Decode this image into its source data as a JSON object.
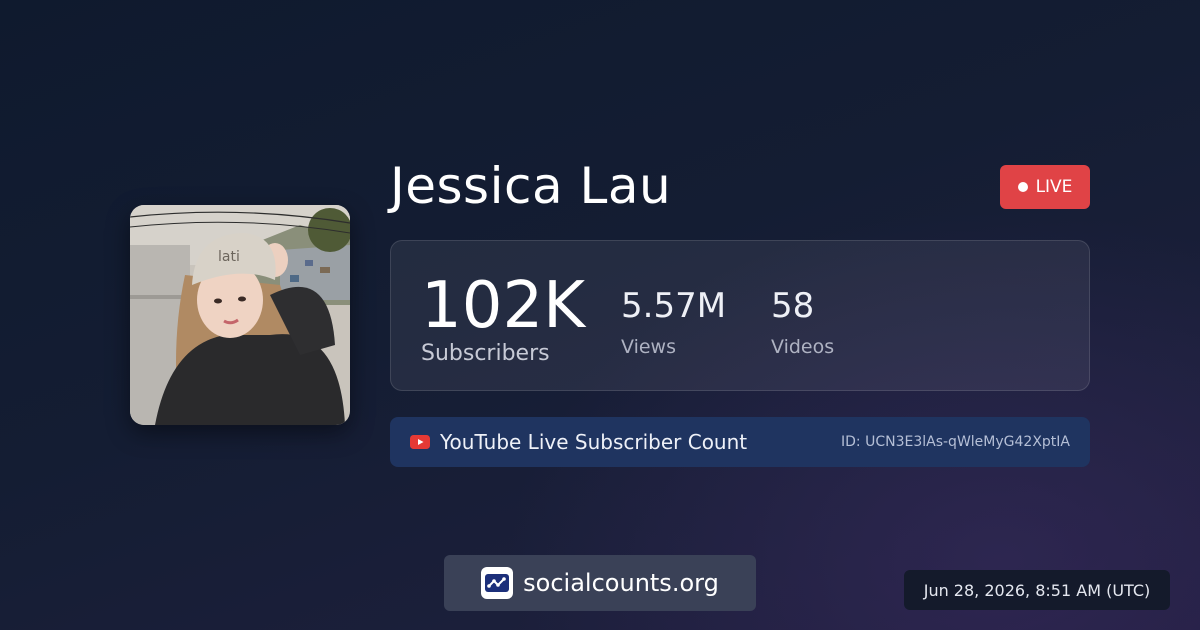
{
  "channel": {
    "name": "Jessica Lau",
    "id_text": "ID: UCN3E3lAs-qWleMyG42XptIA"
  },
  "live_badge": {
    "label": "LIVE"
  },
  "stats": {
    "subscribers": {
      "value": "102K",
      "label": "Subscribers"
    },
    "views": {
      "value": "5.57M",
      "label": "Views"
    },
    "videos": {
      "value": "58",
      "label": "Videos"
    }
  },
  "source": {
    "label": "YouTube Live Subscriber Count",
    "icon": "youtube-icon"
  },
  "brand": {
    "text": "socialcounts.org",
    "icon": "socialcounts-logo-icon"
  },
  "timestamp": "Jun 28, 2026, 8:51 AM (UTC)",
  "colors": {
    "live": "#e04346",
    "youtube": "#e53935",
    "source_bar": "#1f3460",
    "brand_bar": "#3a4157"
  }
}
